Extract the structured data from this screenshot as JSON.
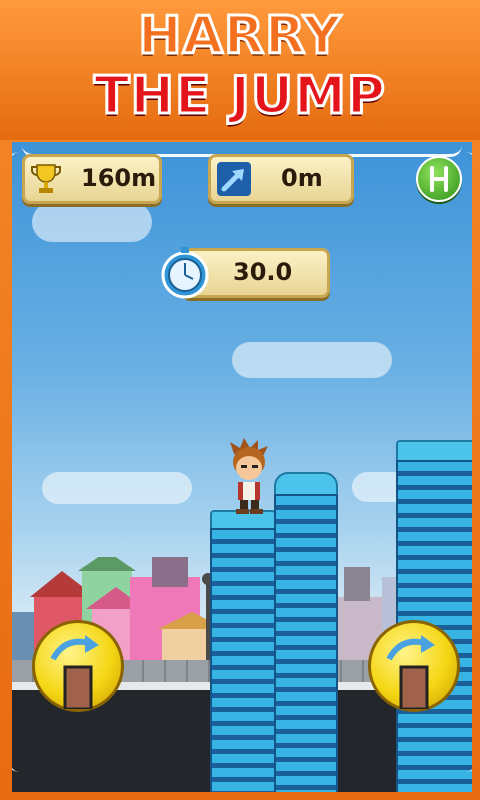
{
  "title": {
    "line1": "HARRY",
    "line2": "THE JUMP"
  },
  "hud": {
    "best_distance": "160m",
    "current_distance": "0m",
    "timer": "30.0",
    "best_icon": "trophy-icon",
    "current_icon": "arrow-up-right-icon",
    "timer_icon": "stopwatch-icon",
    "menu_icon": "leaf-logo-icon"
  },
  "controls": {
    "left_button_icon": "jump-arrow-icon",
    "right_button_icon": "jump-arrow-icon"
  },
  "colors": {
    "frame": "#f07a1c",
    "title_top": "#f37021",
    "title_bottom": "#e4141b",
    "hud_box": "#f5e6ad",
    "tower": "#37b4e3",
    "button": "#f5d614"
  }
}
